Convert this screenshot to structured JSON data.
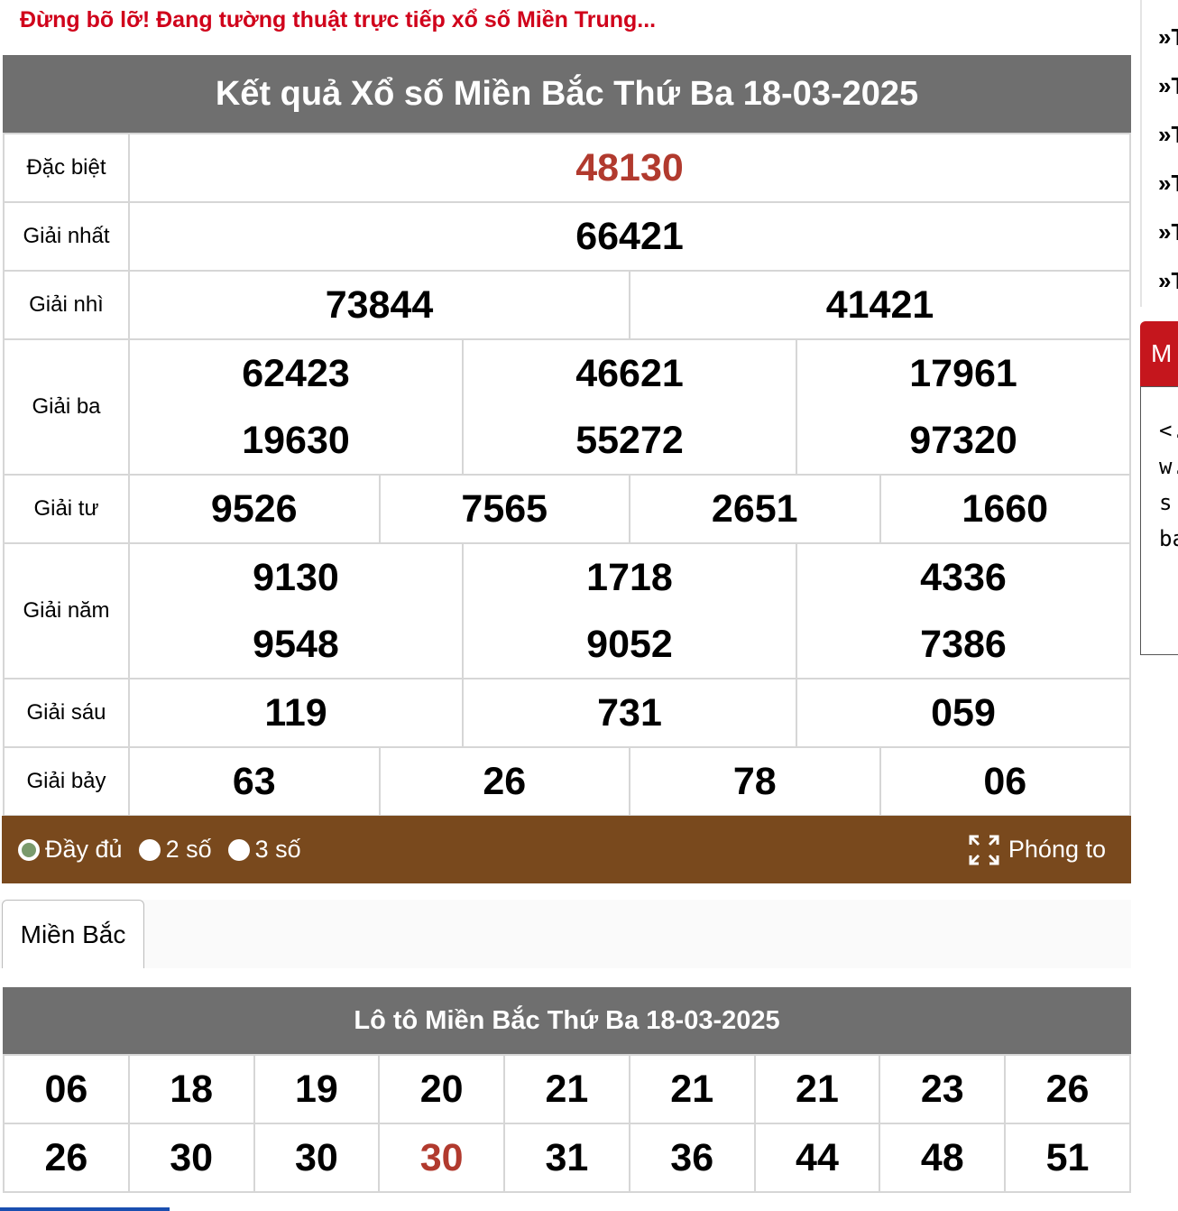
{
  "banner": "Đừng bõ lỡ! Đang tường thuật trực tiếp xổ số Miền Trung...",
  "result_title": "Kết quả Xổ số Miền Bắc Thứ Ba 18-03-2025",
  "prizes": {
    "special": {
      "label": "Đặc biệt",
      "numbers": [
        "48130"
      ]
    },
    "first": {
      "label": "Giải nhất",
      "numbers": [
        "66421"
      ]
    },
    "second": {
      "label": "Giải nhì",
      "numbers": [
        "73844",
        "41421"
      ]
    },
    "third": {
      "label": "Giải ba",
      "numbers": [
        "62423",
        "19630",
        "46621",
        "55272",
        "17961",
        "97320"
      ]
    },
    "fourth": {
      "label": "Giải tư",
      "numbers": [
        "9526",
        "7565",
        "2651",
        "1660"
      ]
    },
    "fifth": {
      "label": "Giải năm",
      "numbers": [
        "9130",
        "9548",
        "1718",
        "9052",
        "4336",
        "7386"
      ]
    },
    "sixth": {
      "label": "Giải sáu",
      "numbers": [
        "119",
        "731",
        "059"
      ]
    },
    "seventh": {
      "label": "Giải bảy",
      "numbers": [
        "63",
        "26",
        "78",
        "06"
      ]
    }
  },
  "toolbar": {
    "options": [
      "Đầy đủ",
      "2 số",
      "3 số"
    ],
    "selected": "Đầy đủ",
    "zoom_label": "Phóng to"
  },
  "tab": {
    "label": "Miền Bắc"
  },
  "loto": {
    "title": "Lô tô Miền Bắc Thứ Ba 18-03-2025",
    "rows": [
      [
        "06",
        "18",
        "19",
        "20",
        "21",
        "21",
        "21",
        "23",
        "26"
      ],
      [
        "26",
        "30",
        "30",
        "30",
        "31",
        "36",
        "44",
        "48",
        "51"
      ]
    ],
    "highlight_color": "#b13a2e"
  },
  "sidebar": {
    "bullets": [
      "»T",
      "»T",
      "»T",
      "»T",
      "»T",
      "»T"
    ],
    "red_tab": "M",
    "code_lines": [
      "<.",
      "w.",
      "s",
      "ba"
    ]
  },
  "colors": {
    "header": "#6f6f6f",
    "toolbar": "#79491d",
    "special": "#b13a2e",
    "banner": "#d0021b"
  }
}
